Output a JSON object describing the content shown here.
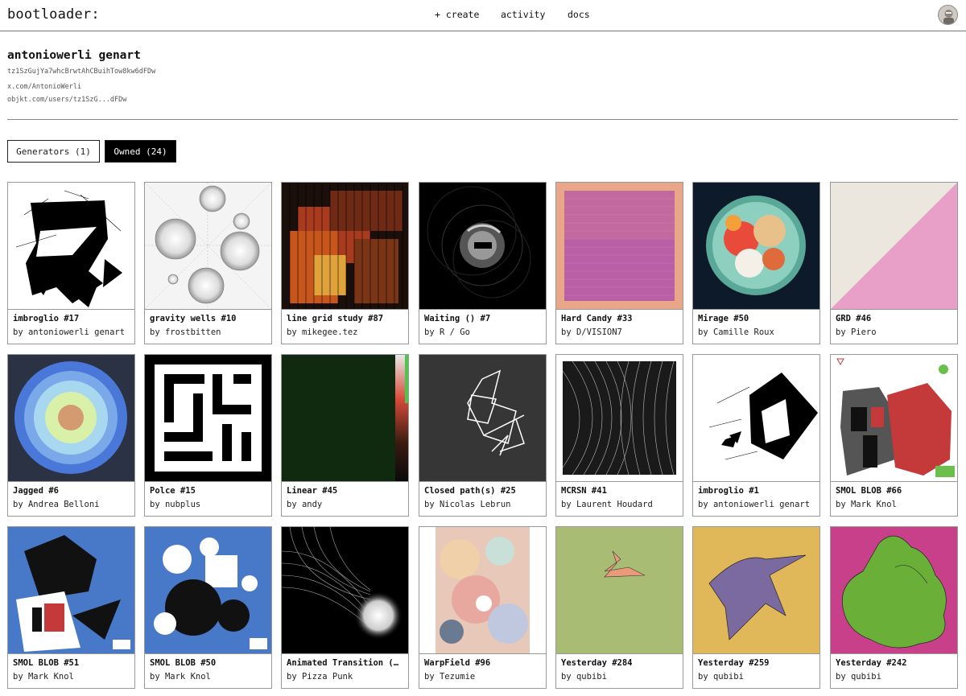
{
  "header": {
    "brand": "bootloader:",
    "nav": {
      "create": "+ create",
      "activity": "activity",
      "docs": "docs"
    }
  },
  "profile": {
    "name": "antoniowerli genart",
    "address": "tz1SzGujYa7whcBrwtAhCBuihTow8kw6dFDw",
    "links": {
      "x": "x.com/AntonioWerli",
      "objkt": "objkt.com/users/tz1SzG...dFDw"
    }
  },
  "tabs": {
    "generators": "Generators (1)",
    "owned": "Owned (24)",
    "active": "owned"
  },
  "cards": [
    {
      "title": "imbroglio #17",
      "artist": "by antoniowerli genart"
    },
    {
      "title": "gravity wells #10",
      "artist": "by frostbitten"
    },
    {
      "title": "line grid study #87",
      "artist": "by mikegee.tez"
    },
    {
      "title": "Waiting () #7",
      "artist": "by R / Go"
    },
    {
      "title": "Hard Candy #33",
      "artist": "by D/VISION7"
    },
    {
      "title": "Mirage #50",
      "artist": "by Camille Roux"
    },
    {
      "title": "GRD #46",
      "artist": "by Piero"
    },
    {
      "title": "Jagged #6",
      "artist": "by Andrea Belloni"
    },
    {
      "title": "Polce #15",
      "artist": "by nubplus"
    },
    {
      "title": "Linear #45",
      "artist": "by andy"
    },
    {
      "title": "Closed path(s) #25",
      "artist": "by Nicolas Lebrun"
    },
    {
      "title": "MCRSN #41",
      "artist": "by Laurent Houdard"
    },
    {
      "title": "imbroglio #1",
      "artist": "by antoniowerli genart"
    },
    {
      "title": "SMOL BLOB #66",
      "artist": "by Mark Knol"
    },
    {
      "title": "SMOL BLOB #51",
      "artist": "by Mark Knol"
    },
    {
      "title": "SMOL BLOB #50",
      "artist": "by Mark Knol"
    },
    {
      "title": "Animated Transition (…",
      "artist": "by Pizza Punk"
    },
    {
      "title": "WarpField #96",
      "artist": "by Tezumie"
    },
    {
      "title": "Yesterday #284",
      "artist": "by qubibi"
    },
    {
      "title": "Yesterday #259",
      "artist": "by qubibi"
    },
    {
      "title": "Yesterday #242",
      "artist": "by qubibi"
    }
  ]
}
